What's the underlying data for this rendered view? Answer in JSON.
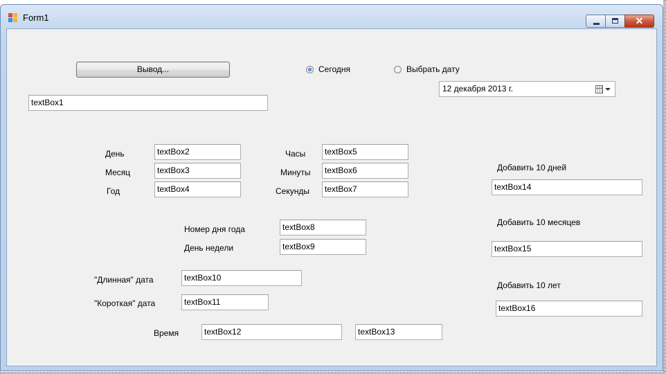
{
  "window": {
    "title": "Form1"
  },
  "output_button": {
    "label": "Вывод..."
  },
  "radios": {
    "today": {
      "label": "Сегодня",
      "checked": true
    },
    "pick_date": {
      "label": "Выбрать дату",
      "checked": false
    }
  },
  "date_picker": {
    "value": "12 декабря  2013 г.",
    "icon": "calendar-dropdown-icon"
  },
  "labels": {
    "day": "День",
    "month": "Месяц",
    "year": "Год",
    "hours": "Часы",
    "minutes": "Минуты",
    "seconds": "Секунды",
    "day_of_year": "Номер дня года",
    "weekday": "День недели",
    "long_date": "\"Длинная\" дата",
    "short_date": "\"Короткая\" дата",
    "time": "Время",
    "add_days": "Добавить 10 дней",
    "add_months": "Добавить 10 месяцев",
    "add_years": "Добавить 10 лет"
  },
  "textboxes": {
    "tb1": "textBox1",
    "tb2": "textBox2",
    "tb3": "textBox3",
    "tb4": "textBox4",
    "tb5": "textBox5",
    "tb6": "textBox6",
    "tb7": "textBox7",
    "tb8": "textBox8",
    "tb9": "textBox9",
    "tb10": "textBox10",
    "tb11": "textBox11",
    "tb12": "textBox12",
    "tb13": "textBox13",
    "tb14": "textBox14",
    "tb15": "textBox15",
    "tb16": "textBox16"
  },
  "colors": {
    "titlebar": "#c9dbf0",
    "client": "#f0f0f0",
    "close_button": "#c95c41"
  }
}
